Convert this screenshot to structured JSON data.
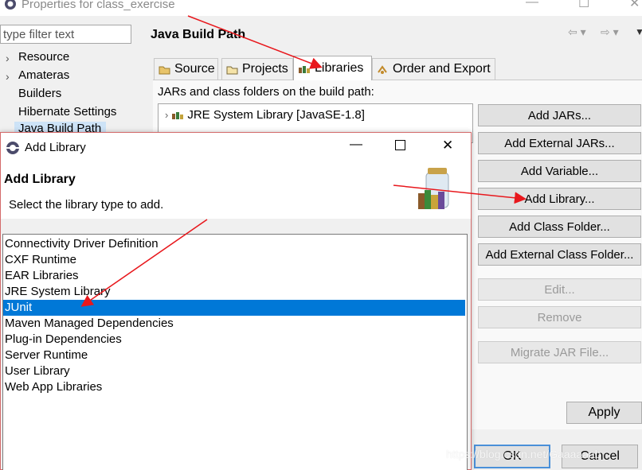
{
  "properties_window": {
    "title": "Properties for class_exercise",
    "filter": {
      "placeholder": "type filter text"
    },
    "tree": [
      {
        "label": "Resource",
        "expandable": true
      },
      {
        "label": "Amateras",
        "expandable": true
      },
      {
        "label": "Builders",
        "expandable": false
      },
      {
        "label": "Hibernate Settings",
        "expandable": false
      },
      {
        "label": "Java Build Path",
        "expandable": false,
        "selected": true
      }
    ],
    "page_title": "Java Build Path",
    "tabs": [
      {
        "label": "Source",
        "icon": "source-folder-icon"
      },
      {
        "label": "Projects",
        "icon": "projects-icon"
      },
      {
        "label": "Libraries",
        "icon": "libraries-icon",
        "active": true
      },
      {
        "label": "Order and Export",
        "icon": "order-export-icon"
      }
    ],
    "build_path_label": "JARs and class folders on the build path:",
    "libraries": [
      {
        "label": "JRE System Library [JavaSE-1.8]"
      }
    ],
    "buttons": {
      "add_jars": "Add JARs...",
      "add_external_jars": "Add External JARs...",
      "add_variable": "Add Variable...",
      "add_library": "Add Library...",
      "add_class_folder": "Add Class Folder...",
      "add_external_class_folder": "Add External Class Folder...",
      "edit": "Edit...",
      "remove": "Remove",
      "migrate_jar": "Migrate JAR File...",
      "apply": "Apply",
      "ok": "OK",
      "cancel": "Cancel"
    }
  },
  "add_library_dialog": {
    "title": "Add Library",
    "heading": "Add Library",
    "description": "Select the library type to add.",
    "selected_index": 4,
    "items": [
      "Connectivity Driver Definition",
      "CXF Runtime",
      "EAR Libraries",
      "JRE System Library",
      "JUnit",
      "Maven Managed Dependencies",
      "Plug-in Dependencies",
      "Server Runtime",
      "User Library",
      "Web App Libraries"
    ]
  },
  "annotations": {
    "arrow_color": "#e8171c"
  },
  "watermark": "https://blog.csdn.net/Gaaaaaab_"
}
